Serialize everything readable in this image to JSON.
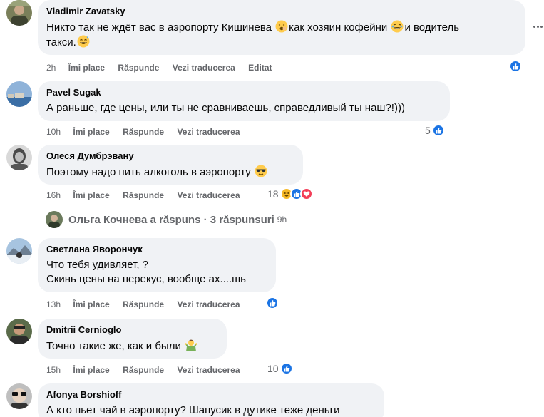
{
  "actions": {
    "like": "Îmi place",
    "reply": "Răspunde",
    "translate": "Vezi traducerea",
    "edited": "Editat"
  },
  "comments": [
    {
      "author": "Vladimir Zavatsky",
      "lines": [
        "Никто так не ждёт вас в аэропорту Кишинева ",
        "как хозяин кофейни ",
        "и водитель",
        "такси."
      ],
      "time": "2h",
      "reaction_count": ""
    },
    {
      "author": "Pavel Sugak",
      "lines": [
        "А раньше, где цены, или ты не сравниваешь, справедливый ты наш?!)))"
      ],
      "time": "10h",
      "reaction_count": "5"
    },
    {
      "author": "Олеся Думбрэвану",
      "lines": [
        "Поэтому надо пить алкоголь в аэропорту "
      ],
      "time": "16h",
      "reaction_count": "18"
    },
    {
      "author": "Светлана Яворончук",
      "lines": [
        "Что тебя удивляет, ?",
        "Скинь цены на перекус, вообще ах....шь"
      ],
      "time": "13h",
      "reaction_count": ""
    },
    {
      "author": "Dmitrii Cernioglo",
      "lines": [
        "Точно такие же, как и были "
      ],
      "time": "15h",
      "reaction_count": "10"
    },
    {
      "author": "Afonya Borshioff",
      "lines": [
        "А кто пьет чай в аэропорту? Шапусик в дутике теже деньги"
      ],
      "time": "",
      "reaction_count": ""
    }
  ],
  "replies_link": {
    "label": "Ольга Кочнева a răspuns · 3 răspunsuri",
    "time": "9h"
  },
  "icons": {
    "like": "like-reaction-icon",
    "haha": "haha-reaction-icon",
    "love": "love-reaction-icon",
    "more": "more-options-icon"
  },
  "colors": {
    "bubble": "#f0f2f5",
    "secondary_text": "#65676b",
    "like_blue": "#1b74e4",
    "haha_yellow": "#f7b928",
    "love_red": "#f33e58"
  }
}
